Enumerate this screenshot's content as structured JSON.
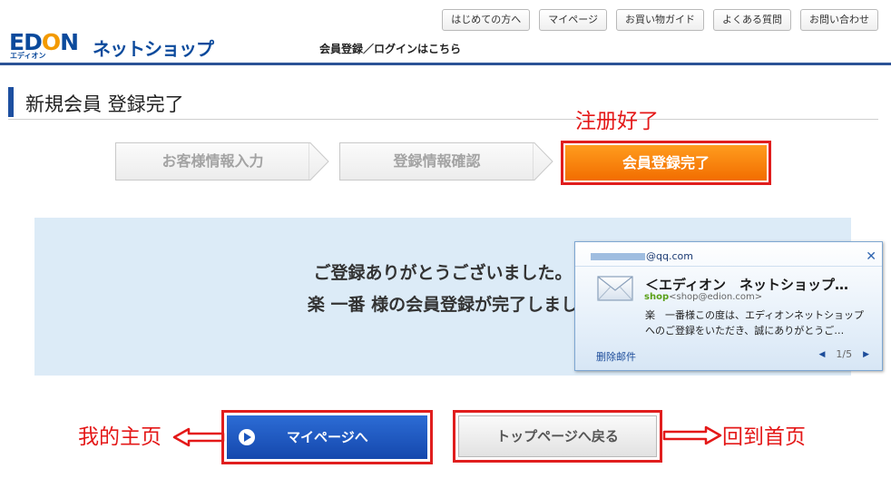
{
  "header": {
    "logo_main": "EDION",
    "logo_shop": "ネットショップ",
    "logo_sub": "エディオン",
    "login_link": "会員登録／ログインはこちら",
    "nav": [
      "はじめての方へ",
      "マイページ",
      "お買い物ガイド",
      "よくある質問",
      "お問い合わせ"
    ]
  },
  "page_title": "新規会員 登録完了",
  "steps": [
    {
      "label": "お客様情報入力",
      "state": "done"
    },
    {
      "label": "登録情報確認",
      "state": "done"
    },
    {
      "label": "会員登録完了",
      "state": "current"
    }
  ],
  "annotations": {
    "registered": "注册好了",
    "my_home": "我的主页",
    "back_home": "回到首页"
  },
  "message": {
    "line1": "ご登録ありがとうございました。",
    "line2": "楽 一番 様の会員登録が完了しまし"
  },
  "notification": {
    "email_suffix": "@qq.com",
    "subject": "＜エディオン　ネットショップ…",
    "from_name": "shop",
    "from_addr": "<shop@edion.com>",
    "preview_line1": "楽　一番様この度は、エディオンネットショップ",
    "preview_line2": "へのご登録をいただき、誠にありがとうご…",
    "delete_label": "删除邮件",
    "pager": "1/5"
  },
  "buttons": {
    "mypage": "マイページへ",
    "top": "トップページへ戻る"
  },
  "colors": {
    "brand_blue": "#0b4a9c",
    "step_orange": "#f57f0a",
    "annotation_red": "#e41818",
    "message_bg": "#dcebf7",
    "button_blue": "#1d5cc4"
  }
}
